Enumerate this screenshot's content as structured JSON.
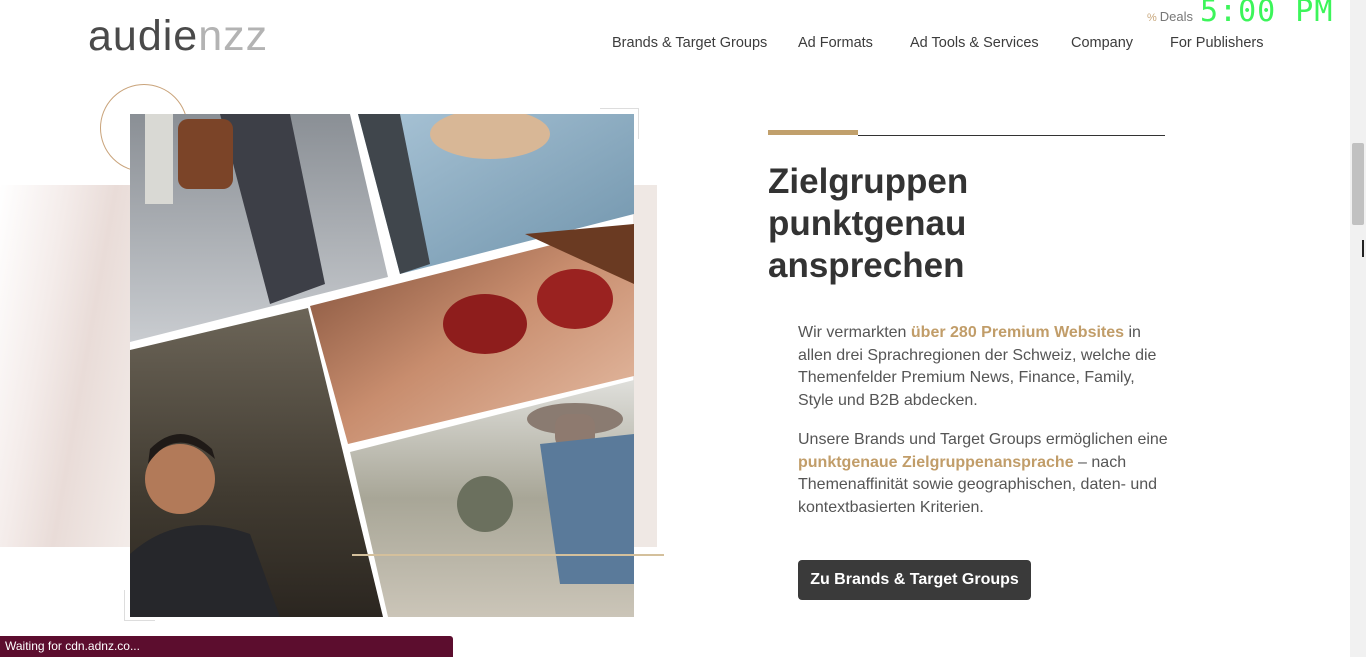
{
  "header": {
    "logo_part1": "audie",
    "logo_part2": "nzz",
    "deals_label": "Deals",
    "clock": "5:00 PM",
    "nav": [
      {
        "label": "Brands & Target Groups"
      },
      {
        "label": "Ad Formats"
      },
      {
        "label": "Ad Tools & Services"
      },
      {
        "label": "Company"
      },
      {
        "label": "For Publishers"
      }
    ]
  },
  "section": {
    "headline": [
      "Zielgruppen",
      "punktgenau",
      "ansprechen"
    ],
    "para1": {
      "before": "Wir vermarkten ",
      "highlight": "über 280 Premium Websites",
      "after": " in allen drei Sprachregionen der Schweiz, welche die Themenfelder Premium News, Finance, Family, Style und B2B abdecken."
    },
    "para2": {
      "before": "Unsere Brands und Target Groups ermöglichen eine ",
      "highlight": "punktgenaue Zielgruppenansprache",
      "after": " – nach Themenaffinität sowie geographischen, daten- und kontextbasierten Kriterien."
    },
    "cta_label": "Zu Brands & Target Groups"
  },
  "status_bar": "Waiting for cdn.adnz.co...",
  "colors": {
    "accent_gold": "#c19d69",
    "button_bg": "#3a3a3a",
    "status_bg": "#5c0d2e",
    "clock_green": "#3cf55a"
  }
}
